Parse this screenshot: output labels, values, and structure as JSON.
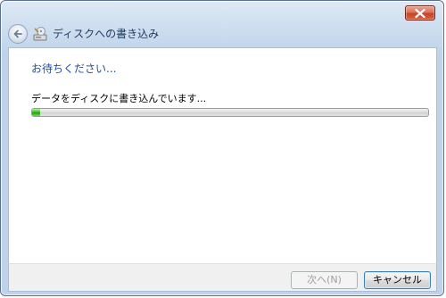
{
  "window": {
    "title": "ディスクへの書き込み"
  },
  "main": {
    "heading": "お待ちください...",
    "status": "データをディスクに書き込んでいます...",
    "progress_fraction": 0.02
  },
  "footer": {
    "next_label": "次へ(N)",
    "cancel_label": "キャンセル"
  },
  "colors": {
    "heading": "#1e4fa3",
    "progress": "#21a30c",
    "close": "#c4452a"
  },
  "icons": [
    "close-icon",
    "back-arrow-icon",
    "disc-drive-icon"
  ]
}
